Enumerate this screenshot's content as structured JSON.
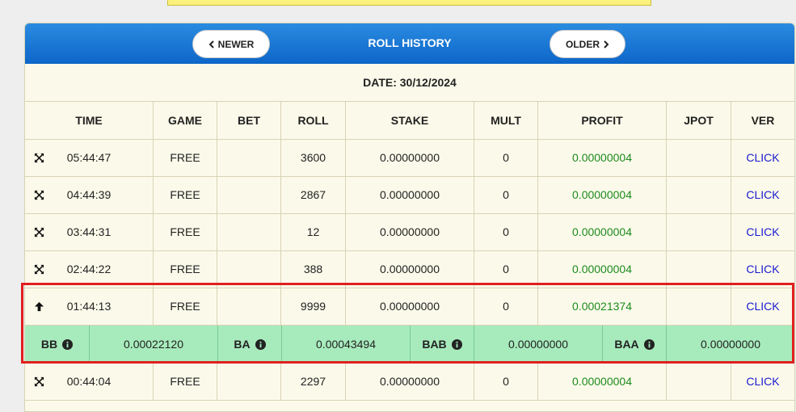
{
  "header": {
    "title": "ROLL HISTORY",
    "newer_label": "NEWER",
    "older_label": "OLDER"
  },
  "date_label": "DATE: 30/12/2024",
  "columns": [
    "TIME",
    "GAME",
    "BET",
    "ROLL",
    "STAKE",
    "MULT",
    "PROFIT",
    "JPOT",
    "VER"
  ],
  "rows": [
    {
      "icon": "expand-arrows-icon",
      "time": "05:44:47",
      "game": "FREE",
      "bet": "",
      "roll": "3600",
      "stake": "0.00000000",
      "mult": "0",
      "profit": "0.00000004",
      "jpot": "",
      "ver": "CLICK"
    },
    {
      "icon": "expand-arrows-icon",
      "time": "04:44:39",
      "game": "FREE",
      "bet": "",
      "roll": "2867",
      "stake": "0.00000000",
      "mult": "0",
      "profit": "0.00000004",
      "jpot": "",
      "ver": "CLICK"
    },
    {
      "icon": "expand-arrows-icon",
      "time": "03:44:31",
      "game": "FREE",
      "bet": "",
      "roll": "12",
      "stake": "0.00000000",
      "mult": "0",
      "profit": "0.00000004",
      "jpot": "",
      "ver": "CLICK"
    },
    {
      "icon": "expand-arrows-icon",
      "time": "02:44:22",
      "game": "FREE",
      "bet": "",
      "roll": "388",
      "stake": "0.00000000",
      "mult": "0",
      "profit": "0.00000004",
      "jpot": "",
      "ver": "CLICK"
    },
    {
      "icon": "arrow-up-icon",
      "time": "01:44:13",
      "game": "FREE",
      "bet": "",
      "roll": "9999",
      "stake": "0.00000000",
      "mult": "0",
      "profit": "0.00021374",
      "jpot": "",
      "ver": "CLICK"
    },
    {
      "icon": "expand-arrows-icon",
      "time": "00:44:04",
      "game": "FREE",
      "bet": "",
      "roll": "2297",
      "stake": "0.00000000",
      "mult": "0",
      "profit": "0.00000004",
      "jpot": "",
      "ver": "CLICK"
    }
  ],
  "bonus": {
    "bb_label": "BB",
    "bb_value": "0.00022120",
    "ba_label": "BA",
    "ba_value": "0.00043494",
    "bab_label": "BAB",
    "bab_value": "0.00000000",
    "baa_label": "BAA",
    "baa_value": "0.00000000"
  },
  "colors": {
    "header": "#1a78d8",
    "profit": "#1e8a1e",
    "link": "#1a1ad0",
    "bonus_bg": "#a7ebbc",
    "highlight": "#e02020"
  }
}
